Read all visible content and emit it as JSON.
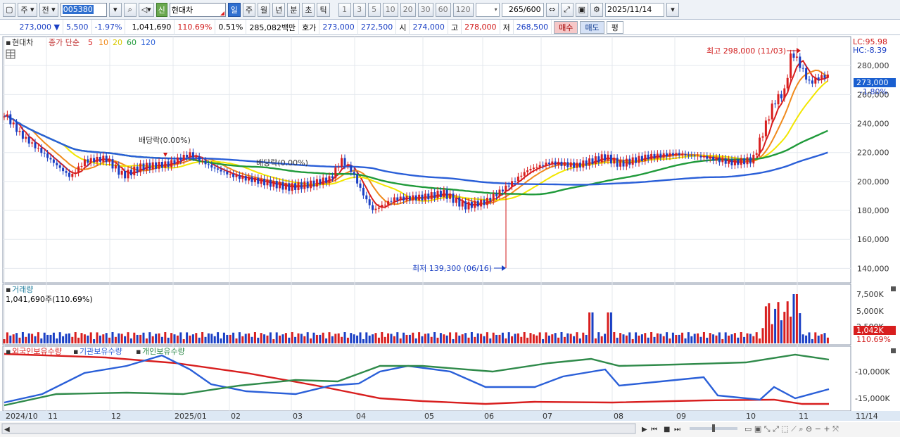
{
  "toolbar": {
    "market": "주",
    "period_type": "전",
    "code": "005380",
    "shin": "신",
    "stock_name": "현대차",
    "timeframes": [
      "일",
      "주",
      "월",
      "년",
      "분",
      "초",
      "틱"
    ],
    "minute_options": [
      "1",
      "3",
      "5",
      "10",
      "20",
      "30",
      "60",
      "120"
    ],
    "count": "265/600",
    "date": "2025/11/14"
  },
  "quote": {
    "price": "273,000",
    "change": "5,500",
    "change_pct": "-1.97%",
    "volume": "1,041,690",
    "volume_ratio": "110.69%",
    "turnover": "0.51%",
    "amount": "285,082백만",
    "bid_ask_label": "호가",
    "ask": "273,000",
    "bid": "272,500",
    "open_label": "시",
    "open": "274,000",
    "high_label": "고",
    "high": "278,000",
    "low_label": "저",
    "low": "268,500",
    "buy": "매수",
    "sell": "매도",
    "flat": "평"
  },
  "price_panel": {
    "title": "현대차",
    "legend_label": "종가 단순",
    "ma_periods": [
      "5",
      "10",
      "20",
      "60",
      "120"
    ],
    "ma_colors": [
      "#d81e1e",
      "#f08a1c",
      "#f2e600",
      "#1f9a3a",
      "#2a5fd8"
    ],
    "lc": "LC:95.98",
    "hc": "HC:-8.39",
    "price_ticks": [
      "280,000",
      "260,000",
      "240,000",
      "220,000",
      "200,000",
      "180,000",
      "160,000",
      "140,000"
    ],
    "current_price_tag": "273,000",
    "current_pct_tag": "-1.80%",
    "high_annotation": "최고 298,000 (11/03)",
    "low_annotation": "최저 139,300 (06/16)",
    "dividend_annotations": [
      "배당락(0.00%)",
      "배당락(0.00%)"
    ]
  },
  "volume_panel": {
    "title": "거래량",
    "value_label": "1,041,690주(110.69%)",
    "ticks": [
      "7,500K",
      "5,000K",
      "2,500K"
    ],
    "current_tag": "1,042K",
    "current_pct": "110.69%"
  },
  "holdings_panel": {
    "legends": [
      "외국인보유수량",
      "기관보유수량",
      "개인보유수량"
    ],
    "colors": [
      "#d81e1e",
      "#2a5fd8",
      "#2f8a4a"
    ],
    "ticks": [
      "-10,000K",
      "-15,000K"
    ]
  },
  "x_axis": {
    "labels": [
      "2024/10",
      "11",
      "12",
      "2025/01",
      "02",
      "03",
      "04",
      "05",
      "06",
      "07",
      "08",
      "09",
      "10",
      "11"
    ],
    "end_label": "11/14"
  },
  "chart_data": {
    "type": "candlestick",
    "title": "현대차",
    "x": [
      "2024/10",
      "11",
      "12",
      "2025/01",
      "02",
      "03",
      "04",
      "05",
      "06",
      "07",
      "08",
      "09",
      "10",
      "11"
    ],
    "close_approx": [
      247000,
      215000,
      212000,
      218000,
      203000,
      196000,
      180000,
      190000,
      185000,
      209000,
      213000,
      218000,
      215000,
      273000
    ],
    "y_range": [
      130000,
      300000
    ],
    "high": 298000,
    "high_date": "11/03",
    "low": 139300,
    "low_date": "06/16",
    "ma_series": [
      "5",
      "10",
      "20",
      "60",
      "120"
    ]
  }
}
